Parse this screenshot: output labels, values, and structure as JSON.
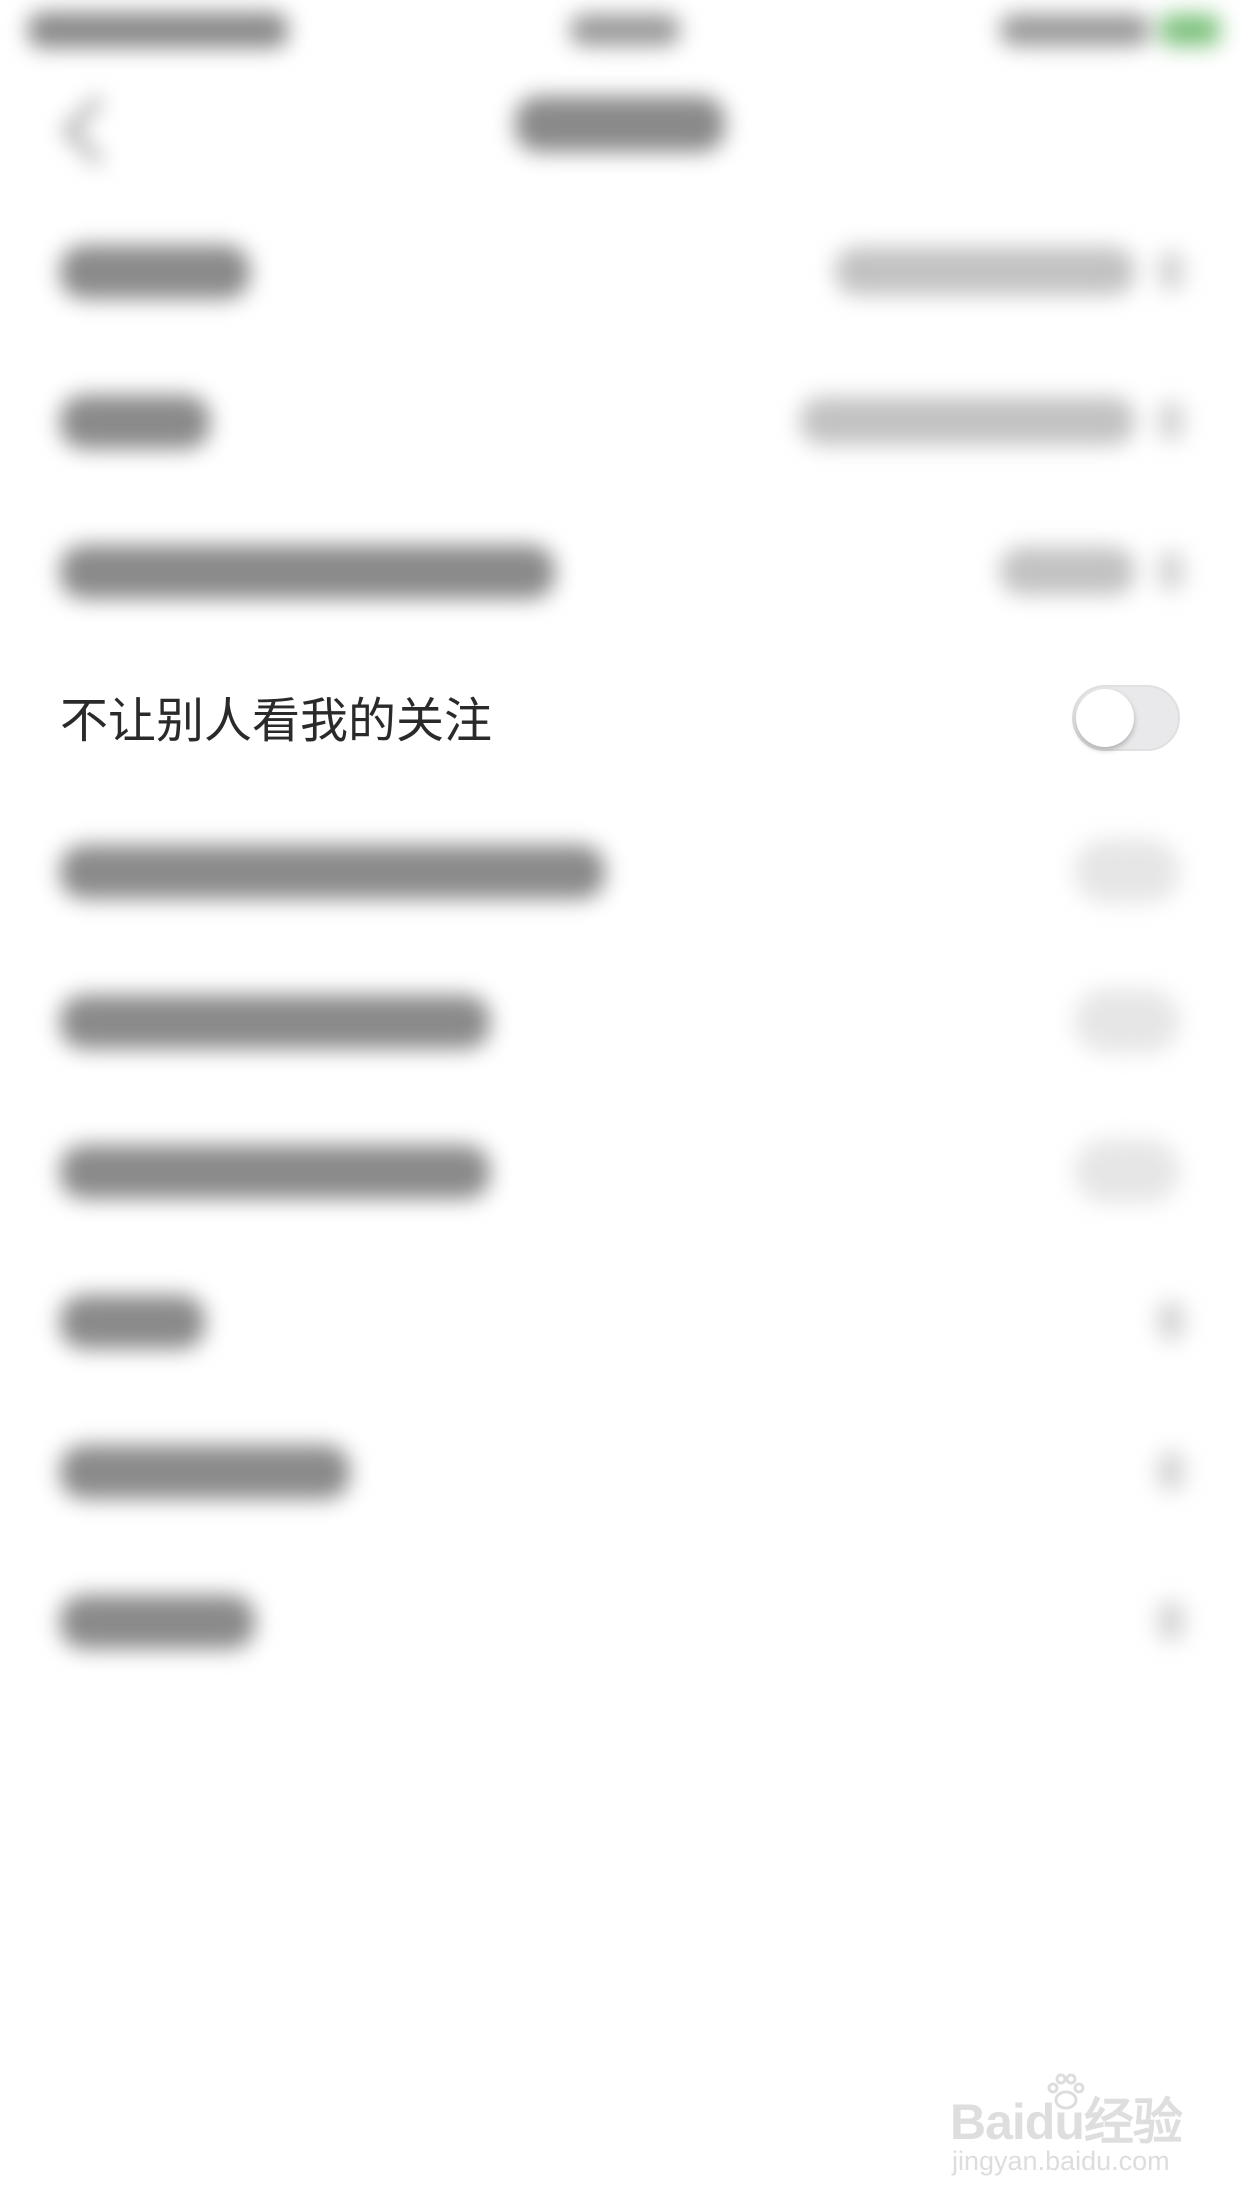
{
  "privacy_settings": {
    "focus_row_label": "不让别人看我的关注",
    "focus_row_toggle_on": false
  },
  "watermark": {
    "logo_text": "Baidu经验",
    "url_text": "jingyan.baidu.com"
  }
}
